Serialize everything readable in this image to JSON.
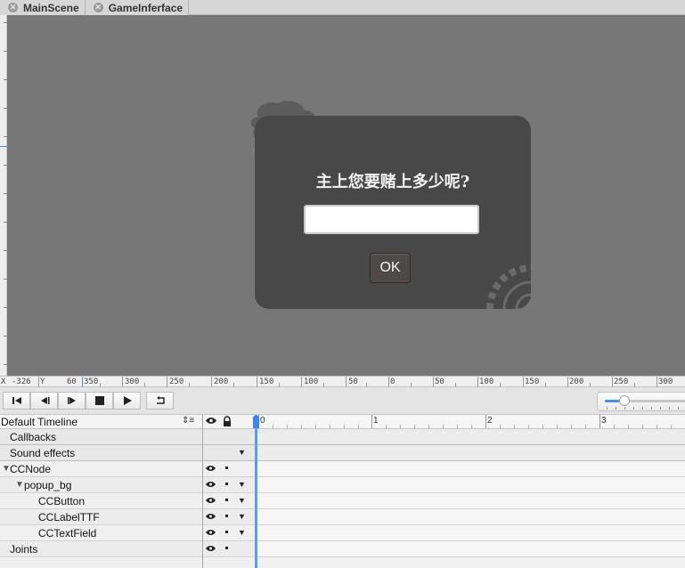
{
  "tabs": [
    {
      "label": "MainScene"
    },
    {
      "label": "GameInferface"
    }
  ],
  "popup": {
    "title": "主上您要赌上多少呢?",
    "input_value": "",
    "ok_label": "OK"
  },
  "ruler": {
    "x_label": "X",
    "x_value": "-326",
    "y_label": "Y",
    "y_value": "60",
    "ticks_left": [
      "350",
      "300",
      "250",
      "200",
      "150",
      "100",
      "50"
    ],
    "ticks_right": [
      "0",
      "50",
      "100",
      "150",
      "200",
      "250",
      "300"
    ]
  },
  "zoom": {
    "level": 0.2
  },
  "timeline": {
    "name": "Default Timeline",
    "seconds": [
      "0",
      "1",
      "2",
      "3"
    ],
    "rows": [
      {
        "label": "Callbacks"
      },
      {
        "label": "Sound effects"
      },
      {
        "label": "CCNode"
      },
      {
        "label": "popup_bg"
      },
      {
        "label": "CCButton"
      },
      {
        "label": "CCLabelTTF"
      },
      {
        "label": "CCTextField"
      },
      {
        "label": "Joints"
      }
    ]
  },
  "colors": {
    "accent": "#4a8fe8",
    "canvas": "#777777",
    "popup": "#484848"
  }
}
